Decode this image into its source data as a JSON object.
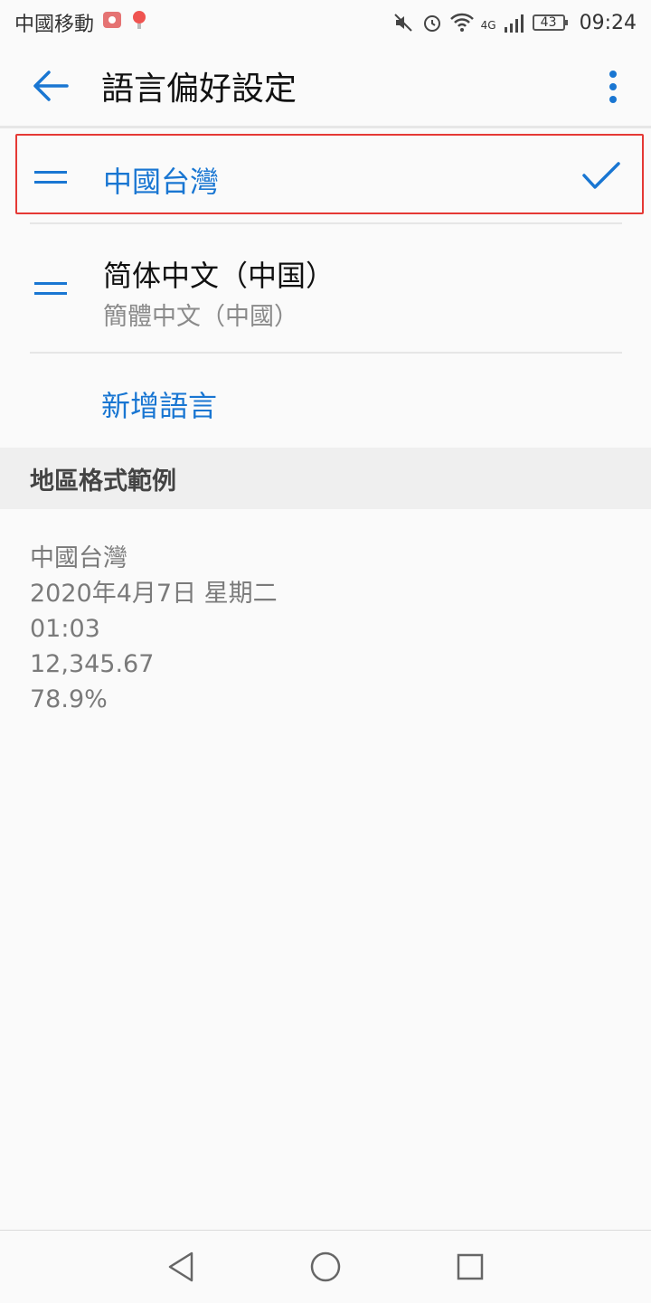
{
  "status_bar": {
    "carrier": "中國移動",
    "battery": "43",
    "network": "4G",
    "time": "09:24"
  },
  "app_bar": {
    "title": "語言偏好設定",
    "back_icon": "arrow-back-icon",
    "more_icon": "more-vert-icon"
  },
  "languages": [
    {
      "name": "中國台灣",
      "selected": true
    },
    {
      "name": "简体中文（中国）",
      "subtitle": "簡體中文（中國）",
      "selected": false
    }
  ],
  "add_language_label": "新增語言",
  "region_format": {
    "header": "地區格式範例",
    "examples": [
      "中國台灣",
      "2020年4月7日 星期二",
      "01:03",
      "12,345.67",
      "78.9%"
    ]
  },
  "colors": {
    "accent": "#1976d2",
    "highlight_border": "#e53935"
  }
}
